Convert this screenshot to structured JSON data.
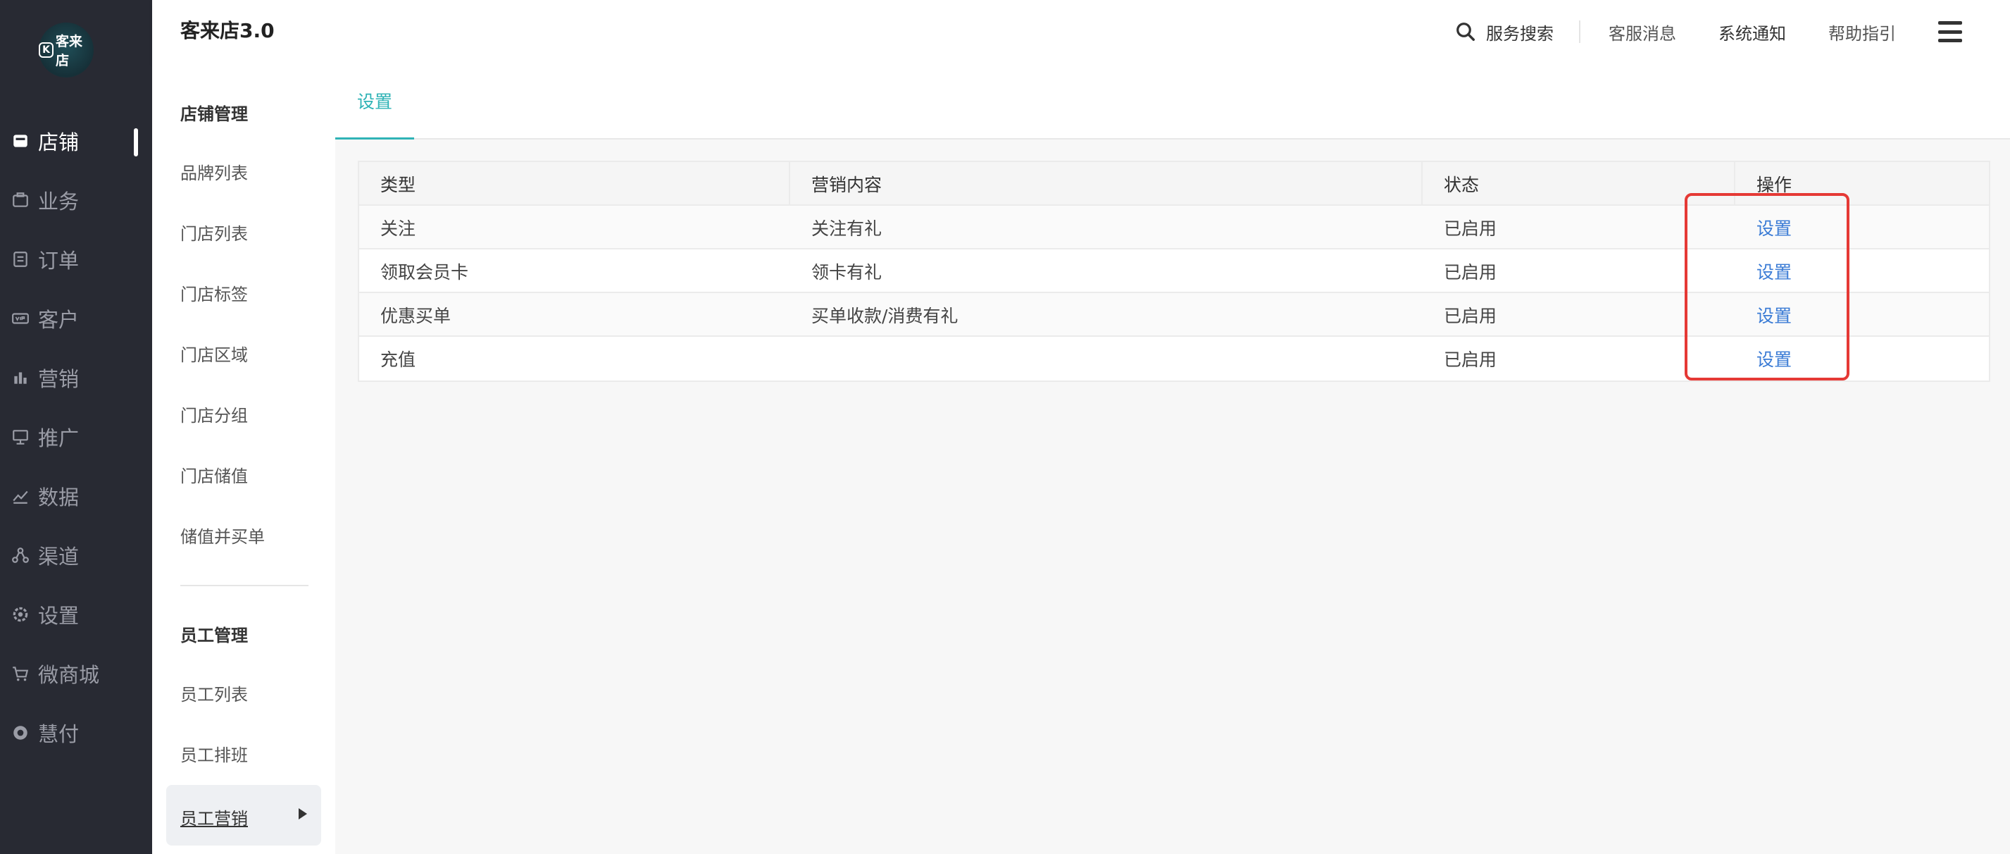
{
  "app": {
    "title": "客来店3.0",
    "logo_text": "客来店",
    "logo_k": "K"
  },
  "header": {
    "search_label": "服务搜索",
    "links": [
      "客服消息",
      "系统通知",
      "帮助指引"
    ]
  },
  "sidebar": {
    "items": [
      {
        "label": "店铺",
        "icon": "store-icon",
        "active": true
      },
      {
        "label": "业务",
        "icon": "briefcase-icon"
      },
      {
        "label": "订单",
        "icon": "order-icon"
      },
      {
        "label": "客户",
        "icon": "vip-icon"
      },
      {
        "label": "营销",
        "icon": "bar-chart-icon"
      },
      {
        "label": "推广",
        "icon": "billboard-icon"
      },
      {
        "label": "数据",
        "icon": "line-chart-icon"
      },
      {
        "label": "渠道",
        "icon": "channel-icon"
      },
      {
        "label": "设置",
        "icon": "gear-icon"
      },
      {
        "label": "微商城",
        "icon": "cart-icon"
      },
      {
        "label": "慧付",
        "icon": "pay-icon"
      }
    ]
  },
  "submenu": {
    "store_heading": "店铺管理",
    "store_items": [
      "品牌列表",
      "门店列表",
      "门店标签",
      "门店区域",
      "门店分组",
      "门店储值",
      "储值并买单"
    ],
    "staff_heading": "员工管理",
    "staff_items": [
      "员工列表",
      "员工排班"
    ],
    "active_item": "员工营销"
  },
  "tabs": {
    "active": "设置"
  },
  "table": {
    "headers": [
      "类型",
      "营销内容",
      "状态",
      "操作"
    ],
    "rows": [
      {
        "type": "关注",
        "content": "关注有礼",
        "status": "已启用",
        "action": "设置"
      },
      {
        "type": "领取会员卡",
        "content": "领卡有礼",
        "status": "已启用",
        "action": "设置"
      },
      {
        "type": "优惠买单",
        "content": "买单收款/消费有礼",
        "status": "已启用",
        "action": "设置"
      },
      {
        "type": "充值",
        "content": "",
        "status": "已启用",
        "action": "设置"
      }
    ]
  },
  "colors": {
    "sidebar_bg": "#282a33",
    "accent": "#2fb3b6",
    "link": "#3a7bd5",
    "highlight": "#e53935"
  }
}
